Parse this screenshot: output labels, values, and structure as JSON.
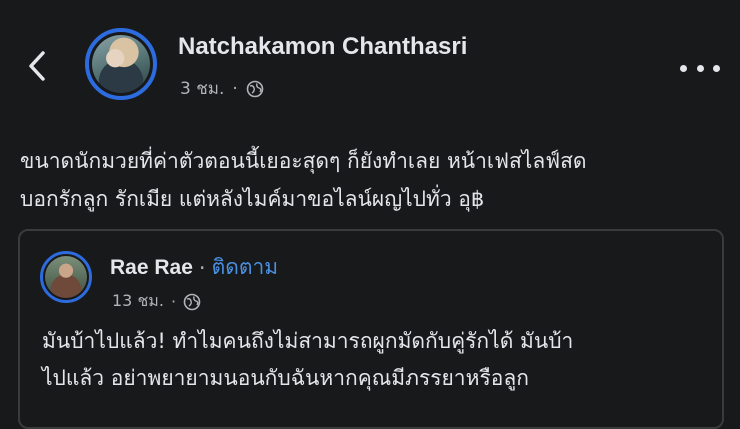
{
  "post": {
    "author": "Natchakamon Chanthasri",
    "time": "3 ชม.",
    "separator": "·",
    "privacy_icon": "globe-icon",
    "lines": [
      "ขนาดนักมวยที่ค่าตัวตอนนี้เยอะสุดๆ ก็ยังทำเลย หน้าเฟสไลฟ์สด",
      "บอกรักลูก รักเมีย แต่หลังไมค์มาขอไลน์ผญไปทั่ว อุ฿"
    ]
  },
  "shared": {
    "author": "Rae Rae",
    "separator": "·",
    "follow_label": "ติดตาม",
    "time": "13 ชม.",
    "privacy_icon": "globe-icon",
    "lines": [
      "มันบ้าไปแล้ว! ทำไมคนถึงไม่สามารถผูกมัดกับคู่รักได้ มันบ้า",
      "ไปแล้ว อย่าพยายามนอนกับฉันหากคุณมีภรรยาหรือลูก"
    ]
  },
  "colors": {
    "background": "#18191a",
    "text": "#e4e6eb",
    "secondary_text": "#b0b3b8",
    "accent": "#4a90e2",
    "ring": "#2d6cdf"
  }
}
